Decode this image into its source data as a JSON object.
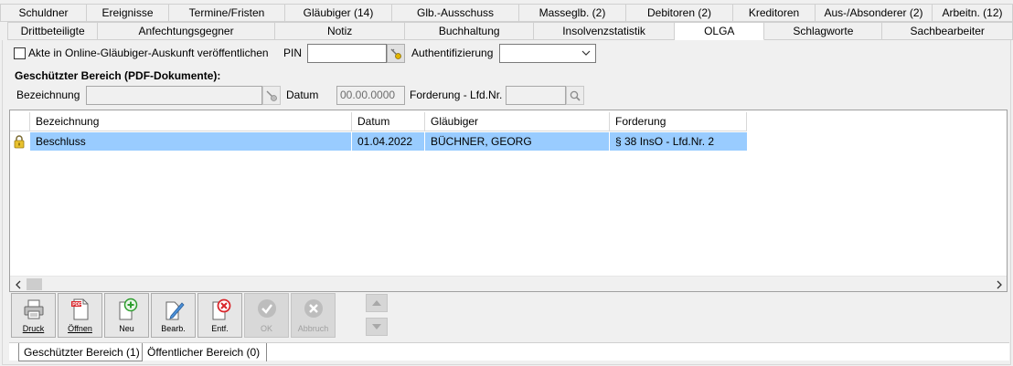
{
  "tabs_row1": [
    "Schuldner",
    "Ereignisse",
    "Termine/Fristen",
    "Gläubiger (14)",
    "Glb.-Ausschuss",
    "Masseglb. (2)",
    "Debitoren (2)",
    "Kreditoren",
    "Aus-/Absonderer (2)",
    "Arbeitn. (12)"
  ],
  "tabs_row2": [
    "Drittbeteiligte",
    "Anfechtungsgegner",
    "Notiz",
    "Buchhaltung",
    "Insolvenzstatistik",
    "OLGA",
    "Schlagworte",
    "Sachbearbeiter"
  ],
  "active_tab": "OLGA",
  "publish": {
    "checkbox_label": "Akte in Online-Gläubiger-Auskunft veröffentlichen",
    "checked": false,
    "pin_label": "PIN",
    "pin_value": "",
    "auth_label": "Authentifizierung",
    "auth_value": ""
  },
  "protected": {
    "heading": "Geschützter Bereich (PDF-Dokumente):",
    "bezeichnung_label": "Bezeichnung",
    "bezeichnung_value": "",
    "datum_label": "Datum",
    "datum_value": "00.00.0000",
    "forderung_label": "Forderung - Lfd.Nr.",
    "forderung_value": ""
  },
  "table": {
    "columns": [
      "Bezeichnung",
      "Datum",
      "Gläubiger",
      "Forderung"
    ],
    "rows": [
      {
        "bezeichnung": "Beschluss",
        "datum": "01.04.2022",
        "glaeubiger": "BÜCHNER, GEORG",
        "forderung": "§ 38 InsO - Lfd.Nr. 2",
        "icon": "lock-icon"
      }
    ]
  },
  "toolbar": {
    "druck": "Druck",
    "oeffnen": "Öffnen",
    "neu": "Neu",
    "bearb": "Bearb.",
    "entf": "Entf.",
    "ok": "OK",
    "abbruch": "Abbruch"
  },
  "bottom_tabs": [
    "Geschützter Bereich (1)",
    "Öffentlicher Bereich (0)"
  ],
  "colors": {
    "selection": "#99ccff",
    "add_green": "#2e9e2e",
    "delete_red": "#d9262b"
  }
}
